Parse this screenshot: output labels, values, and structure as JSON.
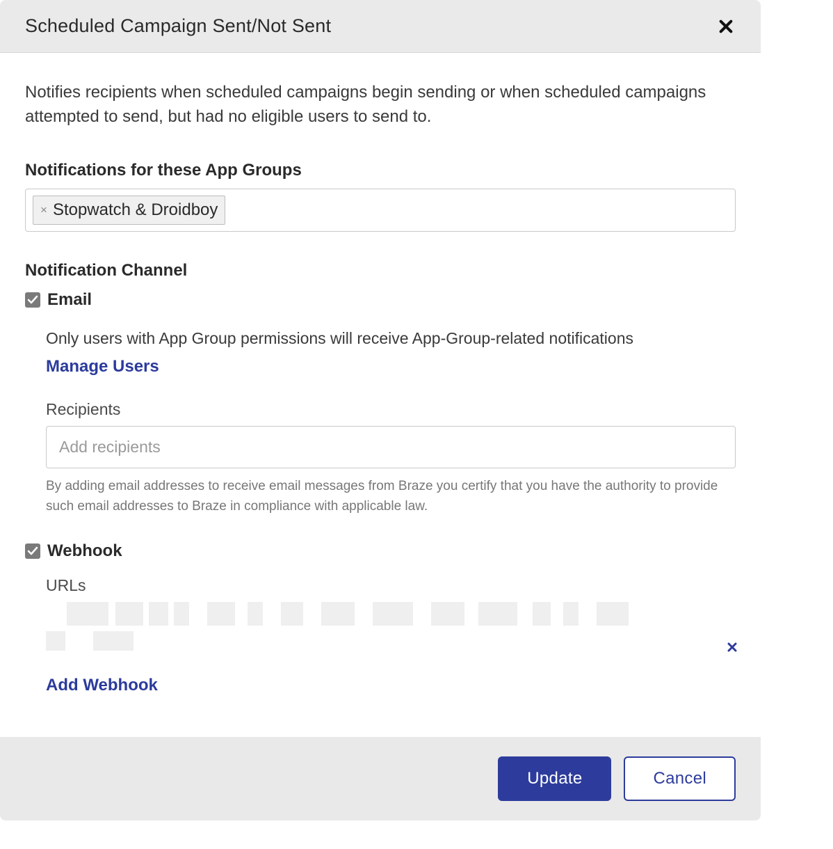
{
  "dialog": {
    "title": "Scheduled Campaign Sent/Not Sent",
    "description": "Notifies recipients when scheduled campaigns begin sending or when scheduled campaigns attempted to send, but had no eligible users to send to."
  },
  "appGroups": {
    "label": "Notifications for these App Groups",
    "tags": [
      {
        "label": "Stopwatch & Droidboy"
      }
    ]
  },
  "channel": {
    "label": "Notification Channel",
    "email": {
      "label": "Email",
      "checked": true,
      "helper": "Only users with App Group permissions will receive App-Group-related notifications",
      "manage_users": "Manage Users",
      "recipients_label": "Recipients",
      "recipients_placeholder": "Add recipients",
      "note": "By adding email addresses to receive email messages from Braze you certify that you have the authority to provide such email addresses to Braze in compliance with applicable law."
    },
    "webhook": {
      "label": "Webhook",
      "checked": true,
      "urls_label": "URLs",
      "add_webhook": "Add Webhook"
    }
  },
  "footer": {
    "update": "Update",
    "cancel": "Cancel"
  }
}
